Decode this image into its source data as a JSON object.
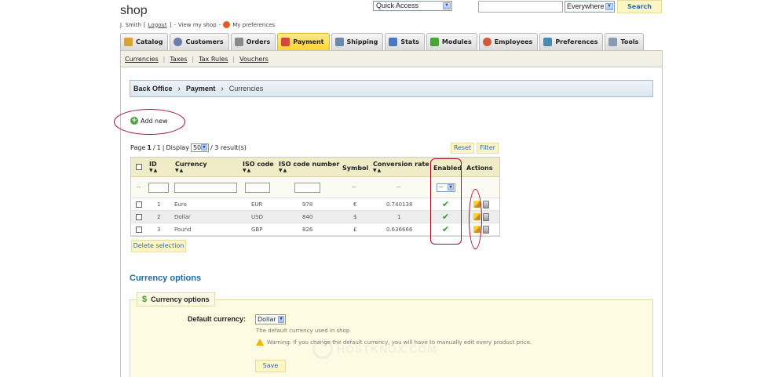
{
  "header": {
    "shop_title": "shop",
    "user_name": "J. Smith",
    "logout": "Logout",
    "view_shop": "View my shop",
    "my_preferences": "My preferences",
    "quick_access": "Quick Access",
    "search_scope": "Everywhere",
    "search_button": "Search",
    "search_value": ""
  },
  "tabs": [
    {
      "label": "Catalog",
      "icon": "catalog-icon",
      "color": "#d7a23a"
    },
    {
      "label": "Customers",
      "icon": "customers-icon",
      "color": "#6a7fa8"
    },
    {
      "label": "Orders",
      "icon": "orders-icon",
      "color": "#8a8a8a"
    },
    {
      "label": "Payment",
      "icon": "payment-icon",
      "color": "#d04a3a"
    },
    {
      "label": "Shipping",
      "icon": "shipping-icon",
      "color": "#6a8aaa"
    },
    {
      "label": "Stats",
      "icon": "stats-icon",
      "color": "#4a78c0"
    },
    {
      "label": "Modules",
      "icon": "modules-icon",
      "color": "#4aa43a"
    },
    {
      "label": "Employees",
      "icon": "employees-icon",
      "color": "#d05a3a"
    },
    {
      "label": "Preferences",
      "icon": "preferences-icon",
      "color": "#4a8ab0"
    },
    {
      "label": "Tools",
      "icon": "tools-icon",
      "color": "#8a9ab0"
    }
  ],
  "subtabs": [
    "Currencies",
    "Taxes",
    "Tax Rules",
    "Vouchers"
  ],
  "breadcrumb": {
    "root": "Back Office",
    "section": "Payment",
    "current": "Currencies"
  },
  "add_new": "Add new",
  "pager": {
    "page_label": "Page",
    "page": "1",
    "pages": "1",
    "display_label": "Display",
    "per_page": "50",
    "results": "/ 3 result(s)"
  },
  "buttons": {
    "reset": "Reset",
    "filter": "Filter",
    "delete_selection": "Delete selection",
    "save": "Save"
  },
  "table": {
    "columns": [
      "ID",
      "Currency",
      "ISO code",
      "ISO code number",
      "Symbol",
      "Conversion rate",
      "Enabled",
      "Actions"
    ],
    "filter_dash": "--",
    "filter_enabled": "--",
    "rows": [
      {
        "id": "1",
        "currency": "Euro",
        "iso": "EUR",
        "iso_num": "978",
        "symbol": "€",
        "rate": "0.740138",
        "enabled": "✔"
      },
      {
        "id": "2",
        "currency": "Dollar",
        "iso": "USD",
        "iso_num": "840",
        "symbol": "$",
        "rate": "1",
        "enabled": "✔"
      },
      {
        "id": "3",
        "currency": "Pound",
        "iso": "GBP",
        "iso_num": "826",
        "symbol": "£",
        "rate": "0.636666",
        "enabled": "✔"
      }
    ]
  },
  "options": {
    "title": "Currency options",
    "legend": "Currency options",
    "default_label": "Default currency:",
    "default_value": "Dollar",
    "hint": "The default currency used in shop",
    "warning": "Warning: If you change the default currency, you will have to manually edit every product price."
  },
  "watermark": "HOSTKNOX.COM"
}
